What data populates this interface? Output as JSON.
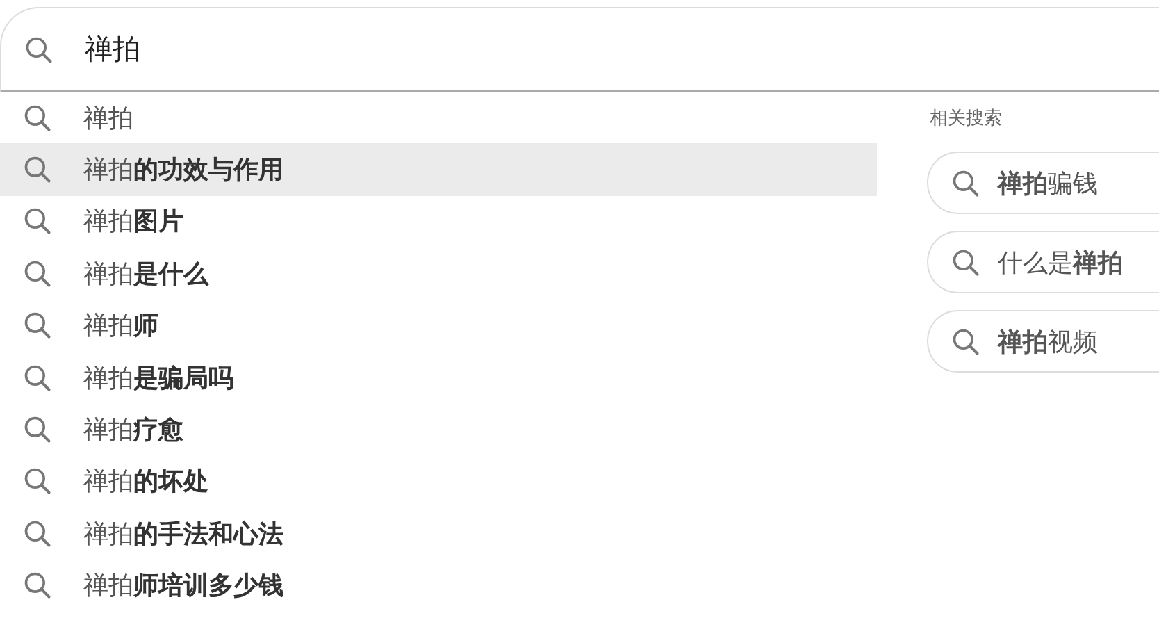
{
  "search": {
    "value": "禅拍"
  },
  "suggestions": [
    {
      "text": "禅拍",
      "selected": false
    },
    {
      "text": "禅拍**的功效与作用**",
      "selected": true
    },
    {
      "text": "禅拍**图片**",
      "selected": false
    },
    {
      "text": "禅拍**是什么**",
      "selected": false
    },
    {
      "text": "禅拍**师**",
      "selected": false
    },
    {
      "text": "禅拍**是骗局吗**",
      "selected": false
    },
    {
      "text": "禅拍**疗愈**",
      "selected": false
    },
    {
      "text": "禅拍**的坏处**",
      "selected": false
    },
    {
      "text": "禅拍**的手法和心法**",
      "selected": false
    },
    {
      "text": "禅拍**师培训多少钱**",
      "selected": false
    }
  ],
  "related": {
    "title": "相关搜索",
    "items": [
      {
        "text": "**禅拍**骗钱"
      },
      {
        "text": "什么是**禅拍**"
      },
      {
        "text": "**禅拍**视频"
      }
    ]
  }
}
